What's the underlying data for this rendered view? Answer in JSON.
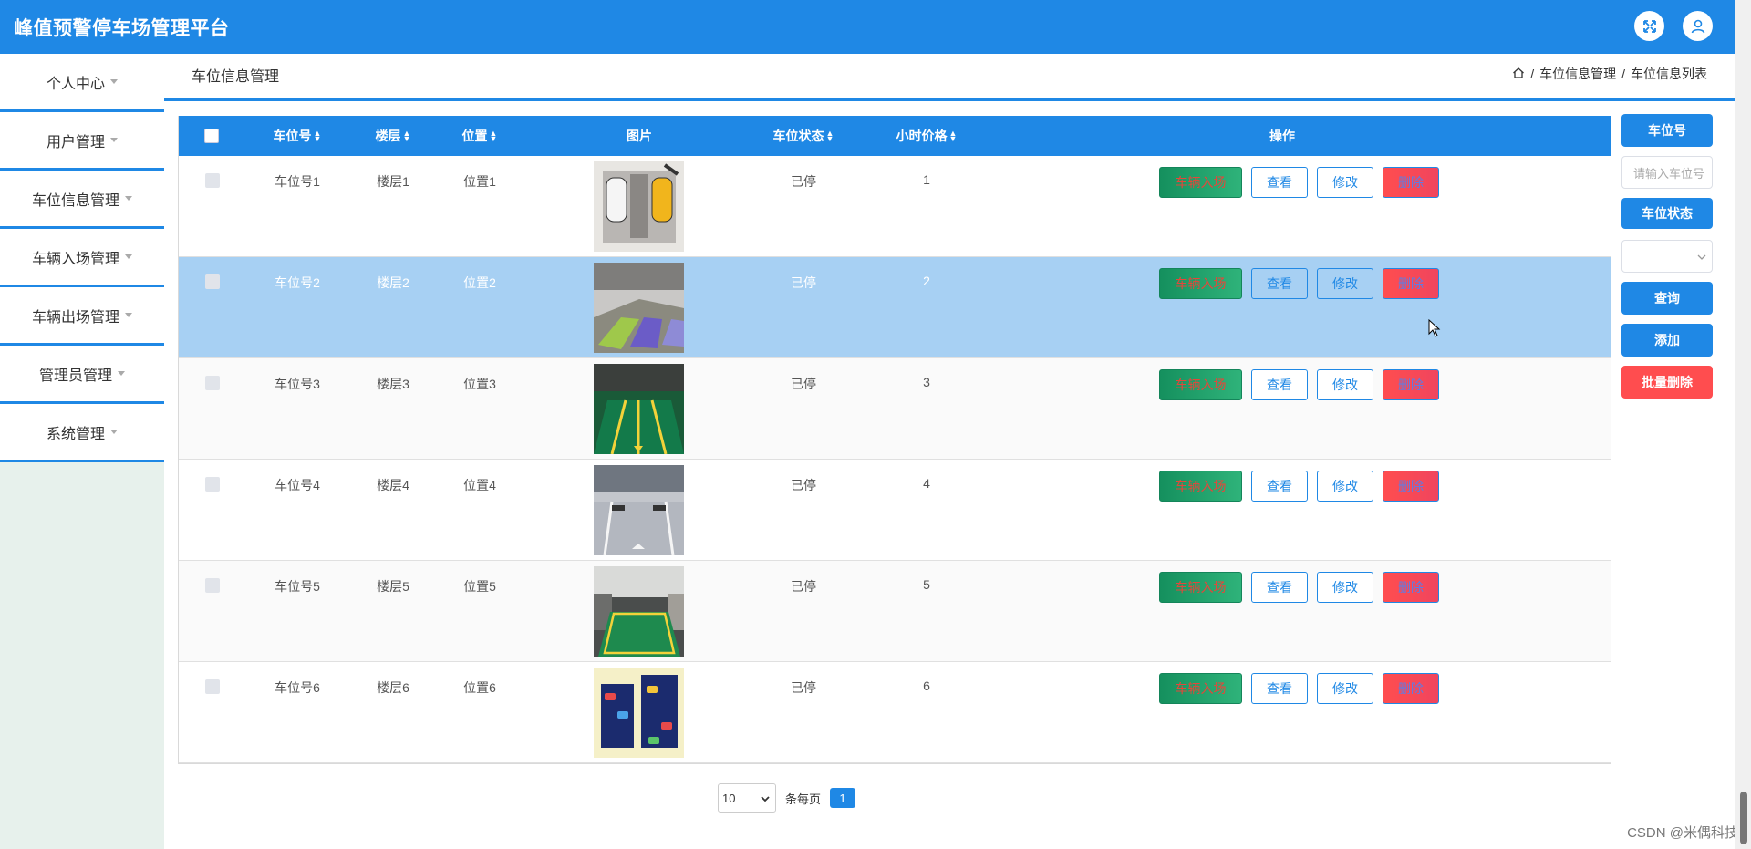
{
  "header": {
    "title": "峰值预警停车场管理平台",
    "fullscreen_icon": "fullscreen-icon",
    "user_icon": "user-icon"
  },
  "sidebar": {
    "items": [
      {
        "label": "个人中心"
      },
      {
        "label": "用户管理"
      },
      {
        "label": "车位信息管理"
      },
      {
        "label": "车辆入场管理"
      },
      {
        "label": "车辆出场管理"
      },
      {
        "label": "管理员管理"
      },
      {
        "label": "系统管理"
      }
    ]
  },
  "page": {
    "title": "车位信息管理",
    "breadcrumb": [
      "车位信息管理",
      "车位信息列表"
    ],
    "breadcrumb_sep": "/"
  },
  "table": {
    "headers": {
      "spot_no": "车位号",
      "floor": "楼层",
      "position": "位置",
      "image": "图片",
      "status": "车位状态",
      "price": "小时价格",
      "actions": "操作"
    },
    "rows": [
      {
        "spot_no": "车位号1",
        "floor": "楼层1",
        "position": "位置1",
        "status": "已停",
        "price": "1"
      },
      {
        "spot_no": "车位号2",
        "floor": "楼层2",
        "position": "位置2",
        "status": "已停",
        "price": "2"
      },
      {
        "spot_no": "车位号3",
        "floor": "楼层3",
        "position": "位置3",
        "status": "已停",
        "price": "3"
      },
      {
        "spot_no": "车位号4",
        "floor": "楼层4",
        "position": "位置4",
        "status": "已停",
        "price": "4"
      },
      {
        "spot_no": "车位号5",
        "floor": "楼层5",
        "position": "位置5",
        "status": "已停",
        "price": "5"
      },
      {
        "spot_no": "车位号6",
        "floor": "楼层6",
        "position": "位置6",
        "status": "已停",
        "price": "6"
      }
    ],
    "row_actions": {
      "enter": "车辆入场",
      "view": "查看",
      "edit": "修改",
      "delete": "删除"
    }
  },
  "search": {
    "spot_label": "车位号",
    "spot_placeholder": "请输入车位号",
    "status_label": "车位状态",
    "status_value": "",
    "query": "查询",
    "add": "添加",
    "batch_delete": "批量删除"
  },
  "pagination": {
    "page_size": "10",
    "per_page_label": "条每页",
    "current_page": "1"
  },
  "watermark": "CSDN @米偶科技",
  "colors": {
    "primary": "#1f88e5",
    "danger": "#ff4d4f",
    "success": "#15905e",
    "highlight_row": "#a7d0f3"
  }
}
